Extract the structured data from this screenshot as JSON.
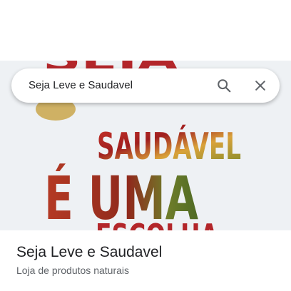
{
  "search": {
    "query": "Seja Leve e Saudavel",
    "search_icon": "search-icon",
    "close_icon": "close-icon"
  },
  "hero_image": {
    "lines": [
      "SEJA",
      "SAUDÁVEL",
      "É UMA",
      "ESCOLHA"
    ]
  },
  "place": {
    "title": "Seja Leve e Saudavel",
    "subtitle": "Loja de produtos naturais"
  },
  "colors": {
    "text_primary": "#202124",
    "text_secondary": "#5f6368",
    "hero_text_red": "#b3262a"
  }
}
